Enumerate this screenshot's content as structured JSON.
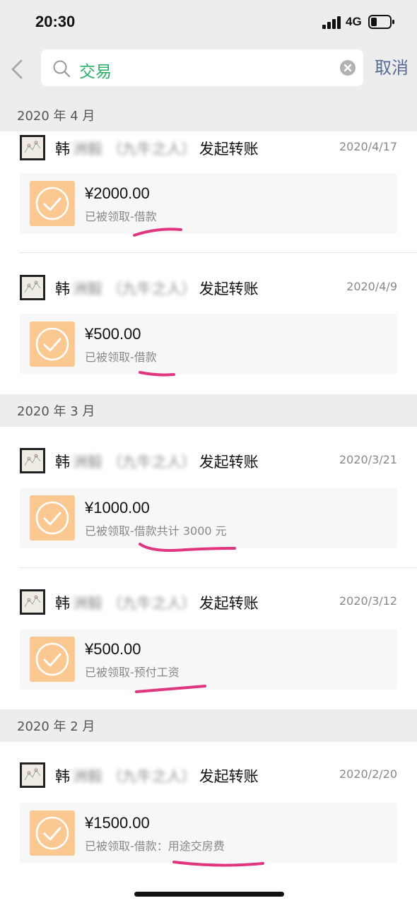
{
  "status": {
    "time": "20:30",
    "network": "4G"
  },
  "search": {
    "query": "交易",
    "cancel": "取消"
  },
  "sections": [
    {
      "label": "2020 年 4 月"
    },
    {
      "label": "2020 年 3 月"
    },
    {
      "label": "2020 年 2 月"
    }
  ],
  "records": [
    {
      "name": "韩",
      "blurred": "洲毅 （九牛之人）",
      "action": "发起转账",
      "date": "2020/4/17",
      "amount": "¥2000.00",
      "note": "已被领取-借款"
    },
    {
      "name": "韩",
      "blurred": "洲毅 （九牛之人）",
      "action": "发起转账",
      "date": "2020/4/9",
      "amount": "¥500.00",
      "note": "已被领取-借款"
    },
    {
      "name": "韩",
      "blurred": "洲毅 （九牛之人）",
      "action": "发起转账",
      "date": "2020/3/21",
      "amount": "¥1000.00",
      "note": "已被领取-借款共计 3000 元"
    },
    {
      "name": "韩",
      "blurred": "洲毅 （九牛之人）",
      "action": "发起转账",
      "date": "2020/3/12",
      "amount": "¥500.00",
      "note": "已被领取-预付工资"
    },
    {
      "name": "韩",
      "blurred": "洲毅 （九牛之人）",
      "action": "发起转账",
      "date": "2020/2/20",
      "amount": "¥1500.00",
      "note": "已被领取-借款：用途交房费"
    }
  ],
  "colors": {
    "accent": "#2aae67",
    "link": "#576b95",
    "transfer_icon": "#fcc891",
    "annotation": "#e0357f"
  }
}
